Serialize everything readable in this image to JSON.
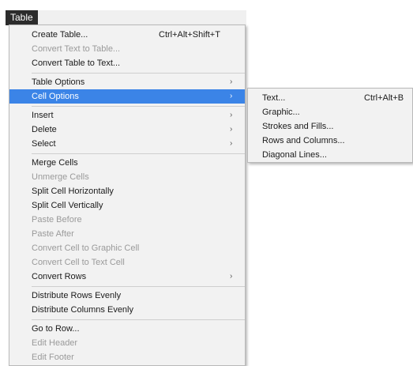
{
  "menubar": {
    "title": "Table"
  },
  "menu": {
    "items": [
      {
        "label": "Create Table...",
        "shortcut": "Ctrl+Alt+Shift+T"
      },
      {
        "label": "Convert Text to Table..."
      },
      {
        "label": "Convert Table to Text..."
      },
      {
        "label": "Table Options"
      },
      {
        "label": "Cell Options"
      },
      {
        "label": "Insert"
      },
      {
        "label": "Delete"
      },
      {
        "label": "Select"
      },
      {
        "label": "Merge Cells"
      },
      {
        "label": "Unmerge Cells"
      },
      {
        "label": "Split Cell Horizontally"
      },
      {
        "label": "Split Cell Vertically"
      },
      {
        "label": "Paste Before"
      },
      {
        "label": "Paste After"
      },
      {
        "label": "Convert Cell to Graphic Cell"
      },
      {
        "label": "Convert Cell to Text Cell"
      },
      {
        "label": "Convert Rows"
      },
      {
        "label": "Distribute Rows Evenly"
      },
      {
        "label": "Distribute Columns Evenly"
      },
      {
        "label": "Go to Row..."
      },
      {
        "label": "Edit Header"
      },
      {
        "label": "Edit Footer"
      }
    ]
  },
  "submenu": {
    "items": [
      {
        "label": "Text...",
        "shortcut": "Ctrl+Alt+B"
      },
      {
        "label": "Graphic..."
      },
      {
        "label": "Strokes and Fills..."
      },
      {
        "label": "Rows and Columns..."
      },
      {
        "label": "Diagonal Lines..."
      }
    ]
  },
  "colors": {
    "highlight": "#3b84e7",
    "menu_background": "#f2f2f2",
    "disabled_text": "#9a9a9a",
    "menubar_active": "#2c2c2c"
  }
}
